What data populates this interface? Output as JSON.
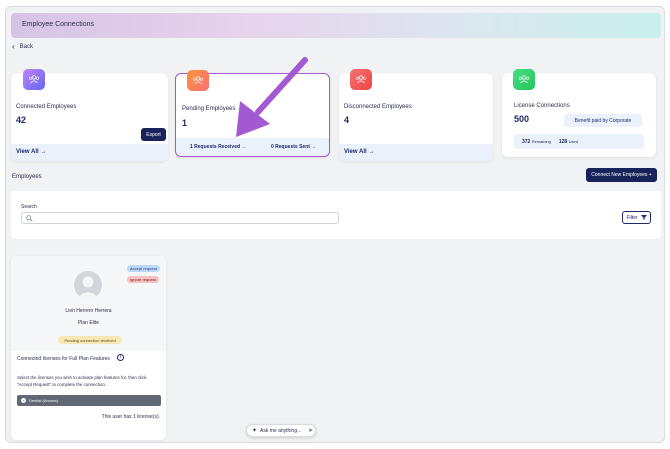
{
  "header": {
    "title": "Employee Connections"
  },
  "back": {
    "label": "Back"
  },
  "cards": {
    "connected": {
      "label": "Connected Employees",
      "count": "42",
      "export_label": "Export",
      "view_all": "View All →",
      "badge_color": "#a855f7"
    },
    "pending": {
      "label": "Pending Employees",
      "count": "1",
      "received": "1 Requests Received →",
      "sent": "0 Requests Sent →",
      "badge_color": "#f87171"
    },
    "disconnected": {
      "label": "Disconnected Employees",
      "count": "4",
      "view_all": "View All →",
      "badge_color": "#ef4444"
    },
    "license": {
      "label": "License Connections",
      "count": "500",
      "benefit": "Benefit paid by Corporate",
      "remaining_num": "372",
      "remaining_label": "Remaining",
      "used_num": "128",
      "used_label": "Used",
      "badge_color": "#22c55e"
    }
  },
  "employees": {
    "section_label": "Employees",
    "connect_button": "Connect New Employees +",
    "search_label": "Search",
    "search_placeholder": "",
    "filter_label": "Filter"
  },
  "employee_card": {
    "accept": "Accept request",
    "ignore": "Ignore request",
    "name": "Lien Herrero Herrera",
    "plan": "Plan Elite",
    "status": "Pending connection received",
    "section_title": "Connected licenses for Full Plan Features",
    "instructions": "Select the licenses you wish to activate plan features for, then click \"Accept Request\" to complete the connection.",
    "license_item": "Dentist (Arcona)",
    "license_count": "This user has 1 license(s)."
  },
  "assistant": {
    "label": "Ask me anything..."
  },
  "colors": {
    "accent": "#17235a",
    "annotation_arrow": "#a259d1"
  }
}
